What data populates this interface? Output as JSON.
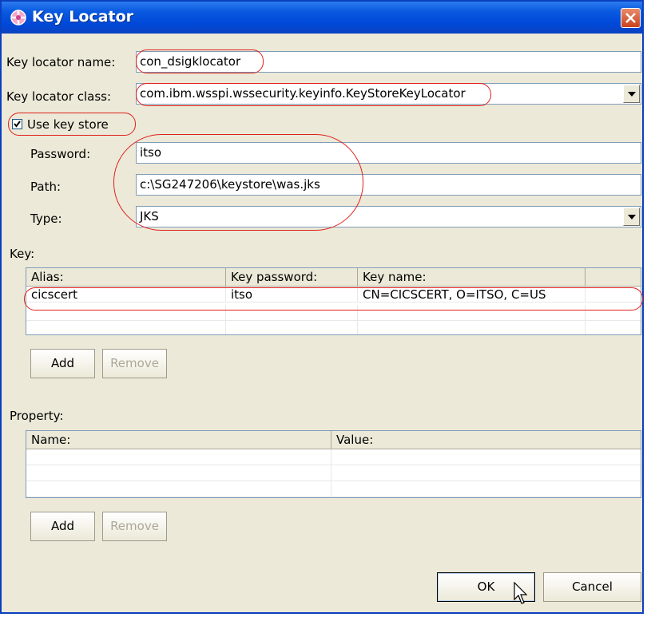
{
  "window": {
    "title": "Key Locator"
  },
  "fields": {
    "key_locator_name_label": "Key locator name:",
    "key_locator_name_value": "con_dsigklocator",
    "key_locator_class_label": "Key locator class:",
    "key_locator_class_value": "com.ibm.wsspi.wssecurity.keyinfo.KeyStoreKeyLocator",
    "use_key_store_label": "Use key store",
    "use_key_store_checked": true
  },
  "keystore": {
    "password_label": "Password:",
    "password_value": "itso",
    "path_label": "Path:",
    "path_value": "c:\\SG247206\\keystore\\was.jks",
    "type_label": "Type:",
    "type_value": "JKS"
  },
  "key_table": {
    "label": "Key:",
    "columns": [
      "Alias:",
      "Key password:",
      "Key name:"
    ],
    "rows": [
      {
        "alias": "cicscert",
        "key_password": "itso",
        "key_name": "CN=CICSCERT,  O=ITSO, C=US"
      }
    ],
    "add_label": "Add",
    "remove_label": "Remove"
  },
  "property_table": {
    "label": "Property:",
    "columns": [
      "Name:",
      "Value:"
    ],
    "rows": [],
    "add_label": "Add",
    "remove_label": "Remove"
  },
  "buttons": {
    "ok": "OK",
    "cancel": "Cancel"
  },
  "colors": {
    "title_bar": "#0a5ae0",
    "highlight_oval": "#e0201c",
    "dialog_bg": "#ece9d8"
  }
}
